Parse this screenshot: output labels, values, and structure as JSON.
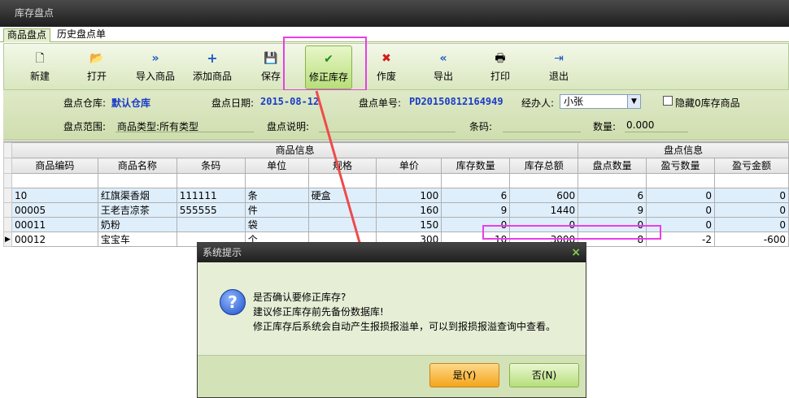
{
  "window": {
    "title": "库存盘点"
  },
  "tabs": [
    {
      "label": "商品盘点"
    },
    {
      "label": "历史盘点单"
    }
  ],
  "toolbar": {
    "new": "新建",
    "open": "打开",
    "import": "导入商品",
    "add": "添加商品",
    "save": "保存",
    "correct": "修正库存",
    "void": "作废",
    "export": "导出",
    "print": "打印",
    "exit": "退出"
  },
  "form": {
    "warehouse_label": "盘点仓库:",
    "warehouse_value": "默认仓库",
    "date_label": "盘点日期:",
    "date_value": "2015-08-12",
    "number_label": "盘点单号:",
    "number_value": "PD20150812164949",
    "handler_label": "经办人:",
    "handler_value": "小张",
    "hide_zero_label": "隐藏0库存商品",
    "scope_label": "盘点范围:",
    "scope_value": "商品类型:所有类型",
    "note_label": "盘点说明:",
    "barcode_label": "条码:",
    "qty_label": "数量:",
    "qty_value": "0.000"
  },
  "grid": {
    "group_product": "商品信息",
    "group_stocktake": "盘点信息",
    "columns": [
      "商品编码",
      "商品名称",
      "条码",
      "单位",
      "规格",
      "单价",
      "库存数量",
      "库存总额",
      "盘点数量",
      "盈亏数量",
      "盈亏金额"
    ],
    "rows": [
      [
        "10",
        "红旗渠香烟",
        "111111",
        "条",
        "硬盒",
        "100",
        "6",
        "600",
        "6",
        "0",
        "0"
      ],
      [
        "00005",
        "王老吉凉茶",
        "555555",
        "件",
        "",
        "160",
        "9",
        "1440",
        "9",
        "0",
        "0"
      ],
      [
        "00011",
        "奶粉",
        "",
        "袋",
        "",
        "150",
        "0",
        "0",
        "0",
        "0",
        "0"
      ],
      [
        "00012",
        "宝宝车",
        "",
        "个",
        "",
        "300",
        "10",
        "3000",
        "8",
        "-2",
        "-600"
      ]
    ]
  },
  "dialog": {
    "title": "系统提示",
    "line1": "是否确认要修正库存?",
    "line2": "建议修正库存前先备份数据库!",
    "line3": "修正库存后系统会自动产生报损报溢单，可以到报损报溢查询中查看。",
    "yes": "是(Y)",
    "no": "否(N)"
  },
  "colors": {
    "highlight": "#e83ee8",
    "arrow": "#ee4b4b",
    "accent": "#1a3cc8"
  }
}
